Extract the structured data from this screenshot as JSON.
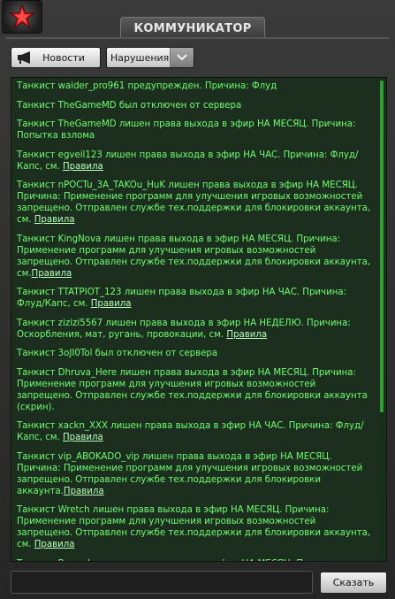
{
  "window": {
    "title": "КОММУНИКАТОР"
  },
  "colors": {
    "message_text": "#6dff6d",
    "log_background": "#1c2f1f",
    "link": "#b8ffb8"
  },
  "toolbar": {
    "news_button": {
      "label": "Новости",
      "icon": "megaphone-icon"
    },
    "filter_select": {
      "value": "Нарушения",
      "icon": "chevron-down-icon"
    }
  },
  "messages": [
    {
      "text": "Танкист waider_pro961 предупрежден. Причина: Флуд",
      "link": ""
    },
    {
      "text": "Танкист TheGameMD был отключен от сервера",
      "link": ""
    },
    {
      "text": "Танкист TheGameMD лишен  права выхода в эфир НА МЕСЯЦ. Причина: Попытка взлома",
      "link": ""
    },
    {
      "text": "Танкист egveil123 лишен  права выхода в эфир НА ЧАС. Причина: Флуд/Капс, см. ",
      "link": "Правила"
    },
    {
      "text": "Танкист nPOCTu_3A_TAKOu_HuK лишен  права выхода в эфир НА МЕСЯЦ. Причина: Применение программ для улучшения игровых возможностей запрещено. Отправлен службе тех.поддержки для блокировки аккаунта, см. ",
      "link": "Правила"
    },
    {
      "text": "Танкист KingNova лишен  права выхода в эфир НА МЕСЯЦ. Причина: Применение программ для улучшения игровых возможностей запрещено. Отправлен службе тех.поддержки для блокировки аккаунта, см.",
      "link": "Правила"
    },
    {
      "text": "Танкист TTATPIOT_123 лишен  права выхода в эфир НА ЧАС. Причина: Флуд/Капс, см. ",
      "link": "Правила"
    },
    {
      "text": "Танкист zizizi5567 лишен  права выхода в эфир НА НЕДЕЛЮ. Причина: Оскорбления, мат, ругань, провокации, см. ",
      "link": "Правила"
    },
    {
      "text": "Танкист 3oJI0Tol был отключен от сервера",
      "link": ""
    },
    {
      "text": "Танкист Dhruva_Here лишен  права выхода в эфир НА МЕСЯЦ. Причина: Применение программ для улучшения игровых возможностей запрещено. Отправлен службе тех.поддержки для блокировки аккаунта (скрин).",
      "link": ""
    },
    {
      "text": "Танкист xackn_XXX лишен  права выхода в эфир НА ЧАС. Причина: Флуд/Капс, см. ",
      "link": "Правила"
    },
    {
      "text": "Танкист vip_ABOKADO_vip лишен  права выхода в эфир НА МЕСЯЦ. Причина: Применение программ для улучшения игровых возможностей запрещено. Отправлен службе тех.поддержки для блокировки аккаунта.",
      "link": "Правила"
    },
    {
      "text": "Танкист Wretch лишен  права выхода в эфир НА МЕСЯЦ. Причина: Применение программ для улучшения игровых возможностей запрещено. Отправлен службе тех.поддержки для блокировки аккаунта, см. ",
      "link": "Правила"
    },
    {
      "text": "Танкист Bormoley лишен  права выхода в эфир НА МЕСЯЦ. Причина: Применение программ для улучшения игровых возможностей запрещено. Отправлен службе тех.поддержки для блокировки аккаунта, см. ",
      "link": "Правила"
    }
  ],
  "composer": {
    "input_value": "",
    "send_label": "Сказать"
  }
}
